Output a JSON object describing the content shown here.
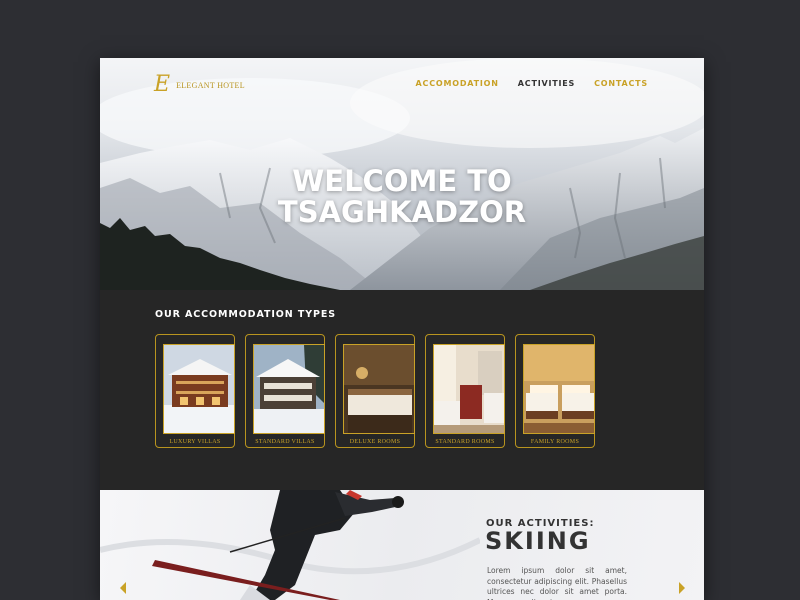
{
  "brand": {
    "logo_letter": "E",
    "name": "ELEGANT HOTEL",
    "accent": "#c9a227"
  },
  "nav": [
    {
      "label": "ACCOMODATION",
      "active": false
    },
    {
      "label": "ACTIVITIES",
      "active": true
    },
    {
      "label": "CONTACTS",
      "active": false
    }
  ],
  "hero": {
    "line1": "WELCOME TO",
    "line2": "TSAGHKADZOR"
  },
  "accommodation": {
    "title": "OUR ACCOMMODATION TYPES",
    "items": [
      {
        "label": "LUXURY VILLAS",
        "icon": "chalet-photo"
      },
      {
        "label": "STANDARD VILLAS",
        "icon": "chalet-photo"
      },
      {
        "label": "DELUXE ROOMS",
        "icon": "room-photo"
      },
      {
        "label": "STANDARD ROOMS",
        "icon": "room-photo"
      },
      {
        "label": "FAMILY ROOMS",
        "icon": "room-photo"
      }
    ]
  },
  "activities": {
    "subtitle": "OUR ACTIVITIES:",
    "title": "SKIING",
    "text": "Lorem ipsum dolor sit amet, consectetur adipiscing elit. Phasellus ultrices nec dolor sit amet porta. Maecenas aliquet"
  }
}
